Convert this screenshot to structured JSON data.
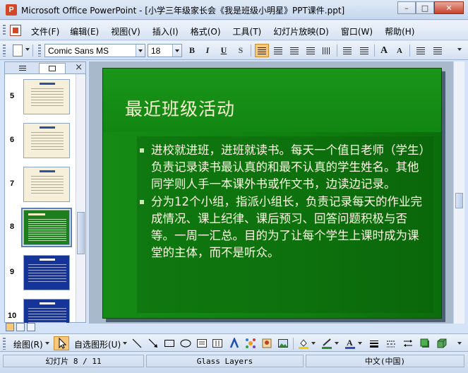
{
  "window": {
    "title": "Microsoft Office PowerPoint - [小学三年级家长会《我是班级小明星》PPT课件.ppt]",
    "minimize_glyph": "–",
    "maximize_glyph": "□",
    "close_glyph": "✕"
  },
  "menu": {
    "items": [
      {
        "label": "文件(F)"
      },
      {
        "label": "编辑(E)"
      },
      {
        "label": "视图(V)"
      },
      {
        "label": "插入(I)"
      },
      {
        "label": "格式(O)"
      },
      {
        "label": "工具(T)"
      },
      {
        "label": "幻灯片放映(D)"
      },
      {
        "label": "窗口(W)"
      },
      {
        "label": "帮助(H)"
      }
    ]
  },
  "format_toolbar": {
    "font_name": "Comic Sans MS",
    "font_size": "18",
    "bold": "B",
    "italic": "I",
    "underline": "U",
    "shadow": "S",
    "grow_font": "A",
    "shrink_font": "A",
    "align_left_active": true
  },
  "outline_pane": {
    "tab_outline_icon": "outline-icon",
    "tab_slides_icon": "slides-icon",
    "close_glyph": "×",
    "thumbnails": [
      {
        "number": "5",
        "style": "parchment"
      },
      {
        "number": "6",
        "style": "parchment"
      },
      {
        "number": "7",
        "style": "parchment"
      },
      {
        "number": "8",
        "style": "green",
        "selected": true
      },
      {
        "number": "9",
        "style": "blue"
      },
      {
        "number": "10",
        "style": "blue"
      }
    ]
  },
  "slide": {
    "title": "最近班级活动",
    "bullets": [
      "进校就进班，进班就读书。每天一个值日老师（学生）负责记录读书最认真的和最不认真的学生姓名。其他同学则人手一本课外书或作文书，边读边记录。",
      "分为12个小组，指派小组长，负责记录每天的作业完成情况、课上纪律、课后预习、回答问题积极与否等。一周一汇总。目的为了让每个学生上课时成为课堂的主体，而不是听众。"
    ],
    "bg_color": "#138313",
    "text_color": "#fffbe6"
  },
  "drawing_toolbar": {
    "draw_label": "绘图(R)",
    "autoshapes_label": "自选图形(U)"
  },
  "status_bar": {
    "slide_indicator": "幻灯片 8 / 11",
    "design": "Glass Layers",
    "language": "中文(中国)"
  }
}
